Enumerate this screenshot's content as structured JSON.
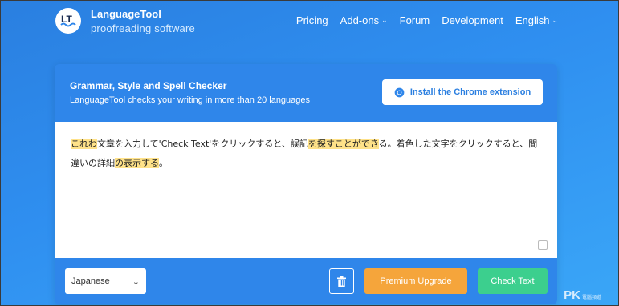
{
  "brand": {
    "name": "LanguageTool",
    "tagline": "proofreading software"
  },
  "nav": {
    "items": [
      {
        "label": "Pricing",
        "has_caret": false
      },
      {
        "label": "Add-ons",
        "has_caret": true
      },
      {
        "label": "Forum",
        "has_caret": false
      },
      {
        "label": "Development",
        "has_caret": false
      },
      {
        "label": "English",
        "has_caret": true
      }
    ]
  },
  "card": {
    "title": "Grammar, Style and Spell Checker",
    "subtitle": "LanguageTool checks your writing in more than 20 languages",
    "chrome_button": "Install the Chrome extension",
    "editor_segments": [
      {
        "text": "これわ",
        "highlight": true
      },
      {
        "text": "文章を入力して'Check Text'をクリックすると、誤記",
        "highlight": false
      },
      {
        "text": "を探すことができ",
        "highlight": true
      },
      {
        "text": "る。着色した文字をクリックすると、間違いの詳細",
        "highlight": false
      },
      {
        "text": "の表示する",
        "highlight": true
      },
      {
        "text": "。",
        "highlight": false
      }
    ],
    "language_select": {
      "value": "Japanese"
    },
    "premium_button": "Premium Upgrade",
    "check_button": "Check Text"
  },
  "watermark": {
    "text": "PK",
    "small": "電腦頻道"
  },
  "colors": {
    "accent": "#2f86ea",
    "highlight": "#ffe289",
    "premium": "#f5a53b",
    "check": "#3ccf8e"
  },
  "icons": {
    "logo": "languagetool-logo-icon",
    "chrome": "chrome-icon",
    "trash": "trash-icon",
    "select_caret": "chevron-down-icon",
    "resize": "resize-handle-icon"
  }
}
